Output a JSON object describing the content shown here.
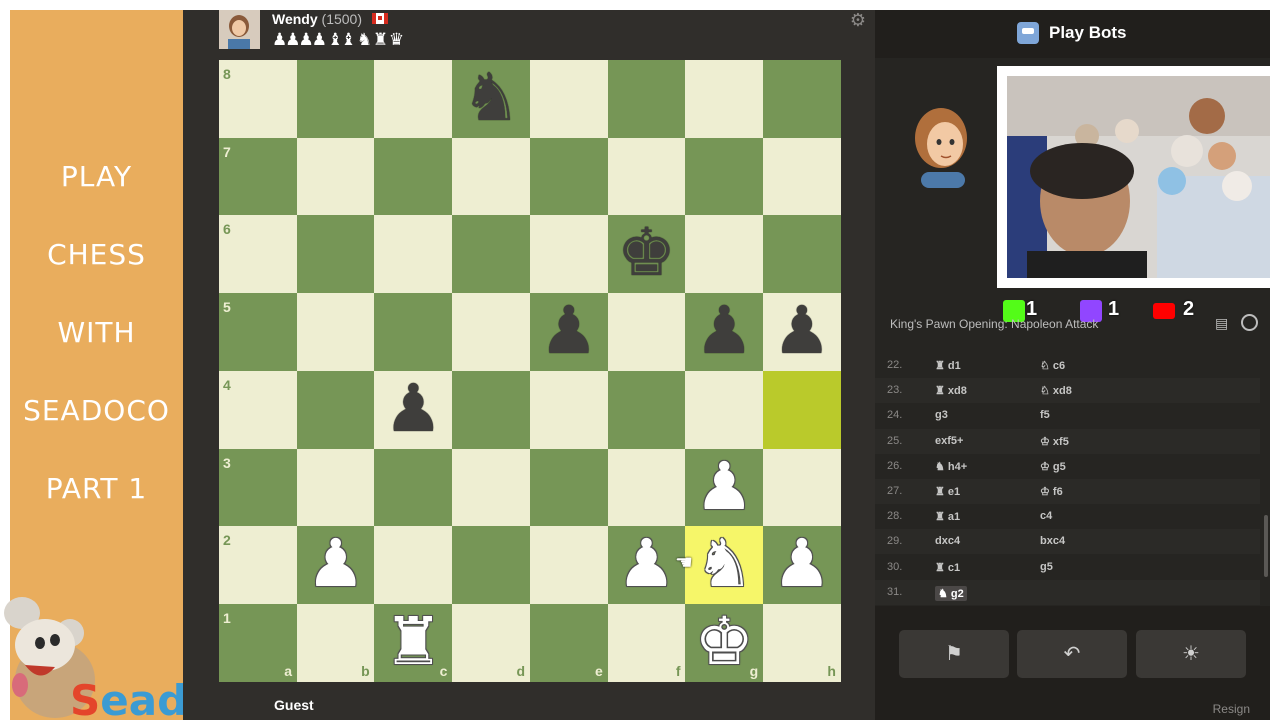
{
  "promo": {
    "lines": [
      "PLAY",
      "CHESS",
      "WITH",
      "SEADOCO",
      "PART 1"
    ],
    "brand_first": "S",
    "brand_rest": "eadoco"
  },
  "top_player": {
    "name": "Wendy",
    "rating": "(1500)",
    "captured": "♟♟♟♟ ♝♝ ♞ ♜ ♛"
  },
  "bottom_player": {
    "name": "Guest"
  },
  "icons": {
    "settings": "⚙",
    "cursor": "☚"
  },
  "board": {
    "ranks": [
      "8",
      "7",
      "6",
      "5",
      "4",
      "3",
      "2",
      "1"
    ],
    "files": [
      "a",
      "b",
      "c",
      "d",
      "e",
      "f",
      "g",
      "h"
    ],
    "highlights": [
      "h4",
      "g2"
    ],
    "pieces": [
      {
        "square": "d8",
        "color": "black",
        "glyph": "♞",
        "name": "black-knight"
      },
      {
        "square": "f6",
        "color": "black",
        "glyph": "♚",
        "name": "black-king"
      },
      {
        "square": "e5",
        "color": "black",
        "glyph": "♟",
        "name": "black-pawn"
      },
      {
        "square": "g5",
        "color": "black",
        "glyph": "♟",
        "name": "black-pawn"
      },
      {
        "square": "h5",
        "color": "black",
        "glyph": "♟",
        "name": "black-pawn"
      },
      {
        "square": "c4",
        "color": "black",
        "glyph": "♟",
        "name": "black-pawn"
      },
      {
        "square": "g3",
        "color": "white",
        "glyph": "♟",
        "name": "white-pawn"
      },
      {
        "square": "b2",
        "color": "white",
        "glyph": "♟",
        "name": "white-pawn"
      },
      {
        "square": "f2",
        "color": "white",
        "glyph": "♟",
        "name": "white-pawn"
      },
      {
        "square": "g2",
        "color": "white",
        "glyph": "♞",
        "name": "white-knight"
      },
      {
        "square": "h2",
        "color": "white",
        "glyph": "♟",
        "name": "white-pawn"
      },
      {
        "square": "c1",
        "color": "white",
        "glyph": "♜",
        "name": "white-rook"
      },
      {
        "square": "g1",
        "color": "white",
        "glyph": "♚",
        "name": "white-king"
      }
    ]
  },
  "panel": {
    "title": "Play Bots",
    "opening": "King's Pawn Opening: Napoleon Attack",
    "social": [
      {
        "icon": "kick-icon",
        "count": "1",
        "color": "#53fc18"
      },
      {
        "icon": "twitch-icon",
        "count": "1",
        "color": "#9146ff"
      },
      {
        "icon": "youtube-icon",
        "count": "2",
        "color": "#ff0000"
      }
    ],
    "moves": [
      {
        "num": "22.",
        "white": "♜ d1",
        "black": "♘ c6"
      },
      {
        "num": "23.",
        "white": "♜ xd8",
        "black": "♘ xd8"
      },
      {
        "num": "24.",
        "white": "g3",
        "black": "f5"
      },
      {
        "num": "25.",
        "white": "exf5+",
        "black": "♔ xf5"
      },
      {
        "num": "26.",
        "white": "♞ h4+",
        "black": "♔ g5"
      },
      {
        "num": "27.",
        "white": "♜ e1",
        "black": "♔ f6"
      },
      {
        "num": "28.",
        "white": "♜ a1",
        "black": "c4"
      },
      {
        "num": "29.",
        "white": "dxc4",
        "black": "bxc4"
      },
      {
        "num": "30.",
        "white": "♜ c1",
        "black": "g5"
      },
      {
        "num": "31.",
        "white": "♞ g2",
        "black": ""
      }
    ],
    "buttons": {
      "resign_flag": "⚑",
      "back_arrow": "↶",
      "hint_bulb": "☀"
    },
    "footer_resign": "Resign"
  }
}
